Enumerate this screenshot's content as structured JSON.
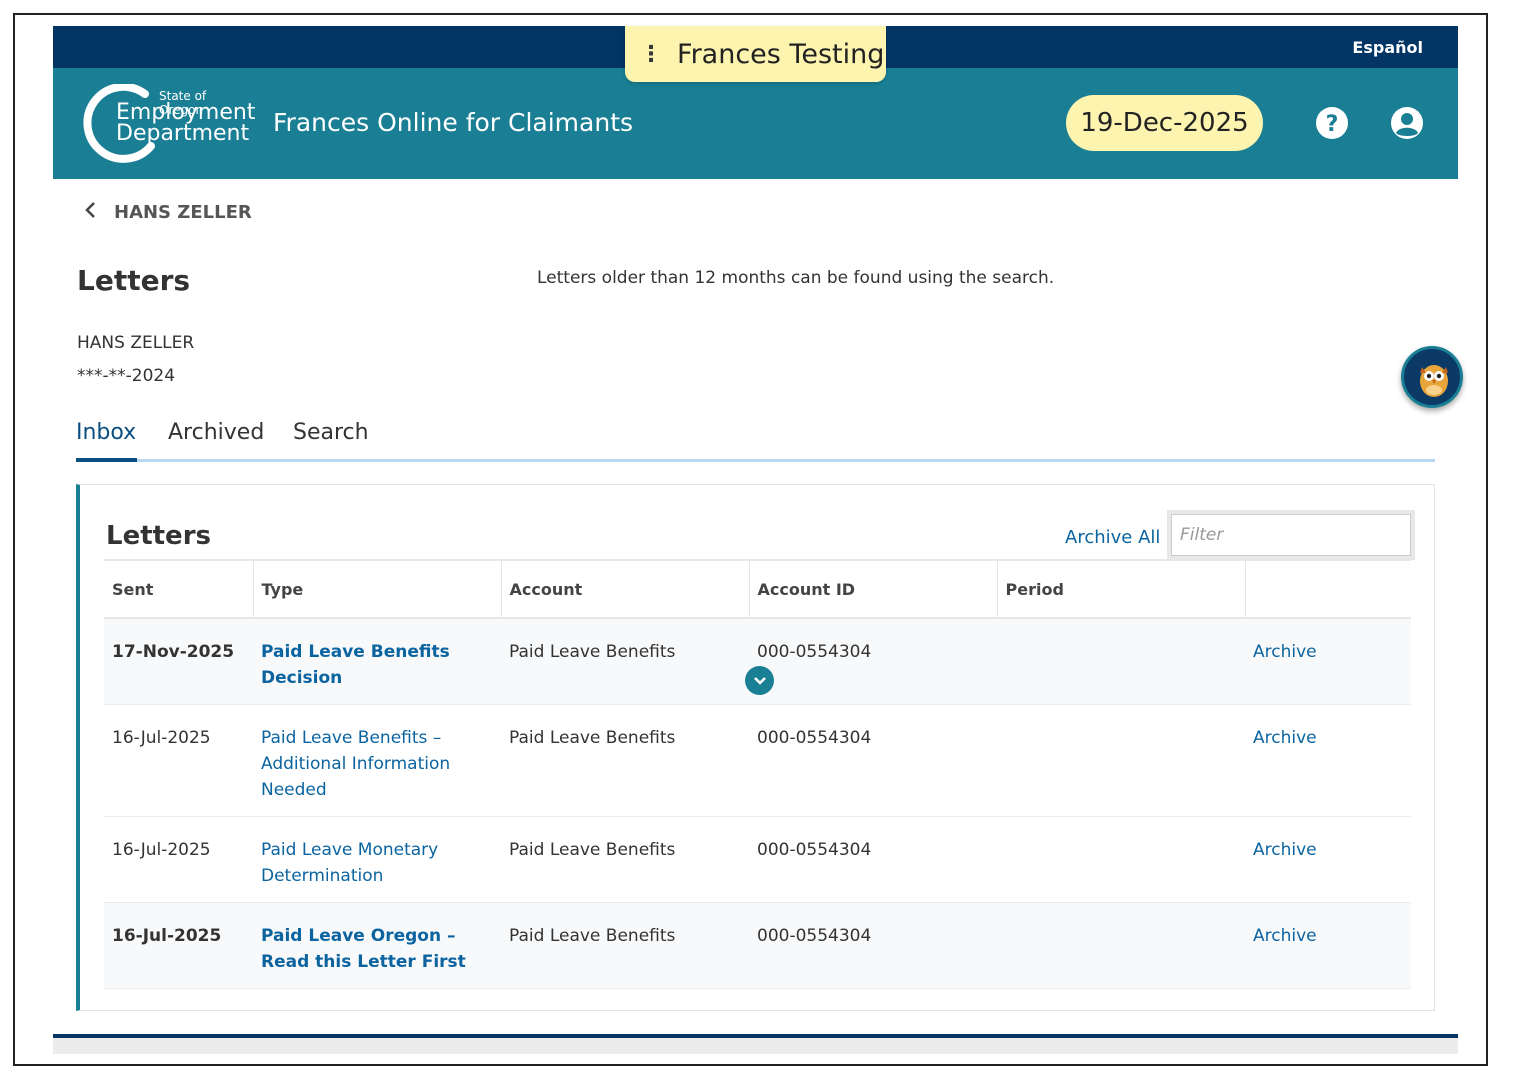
{
  "env": {
    "menu_glyph": "⋮",
    "label": "Frances Testing"
  },
  "topbar": {
    "language_link": "Español"
  },
  "header": {
    "logo": {
      "state": "State of Oregon",
      "line1": "Employment",
      "line2": "Department"
    },
    "app_title": "Frances Online for Claimants",
    "date": "19-Dec-2025",
    "help_icon": "help-circle-icon",
    "account_icon": "user-circle-icon"
  },
  "breadcrumb": {
    "back_label": "HANS ZELLER"
  },
  "page": {
    "title": "Letters",
    "note": "Letters older than 12 months can be found using the search.",
    "claimant_name": "HANS ZELLER",
    "claimant_ssn": "***-**-2024"
  },
  "tabs": [
    {
      "label": "Inbox",
      "active": true
    },
    {
      "label": "Archived",
      "active": false
    },
    {
      "label": "Search",
      "active": false
    }
  ],
  "letters_card": {
    "title": "Letters",
    "archive_all": "Archive All",
    "filter_placeholder": "Filter",
    "columns": [
      "Sent",
      "Type",
      "Account",
      "Account ID",
      "Period",
      ""
    ],
    "rows": [
      {
        "sent": "17-Nov-2025",
        "type": "Paid Leave Benefits Decision",
        "account": "Paid Leave Benefits",
        "account_id": "000-0554304",
        "period": "",
        "action": "Archive",
        "unread": true
      },
      {
        "sent": "16-Jul-2025",
        "type": "Paid Leave Benefits – Additional Information Needed",
        "account": "Paid Leave Benefits",
        "account_id": "000-0554304",
        "period": "",
        "action": "Archive",
        "unread": false
      },
      {
        "sent": "16-Jul-2025",
        "type": "Paid Leave Monetary Determination",
        "account": "Paid Leave Benefits",
        "account_id": "000-0554304",
        "period": "",
        "action": "Archive",
        "unread": false
      },
      {
        "sent": "16-Jul-2025",
        "type": "Paid Leave Oregon – Read this Letter First",
        "account": "Paid Leave Benefits",
        "account_id": "000-0554304",
        "period": "",
        "action": "Archive",
        "unread": true
      }
    ]
  },
  "colors": {
    "header": "#1a7f94",
    "topbar": "#023564",
    "badge": "#fdf4b0",
    "link": "#0b64a0",
    "tab_active": "#0b4f82"
  }
}
